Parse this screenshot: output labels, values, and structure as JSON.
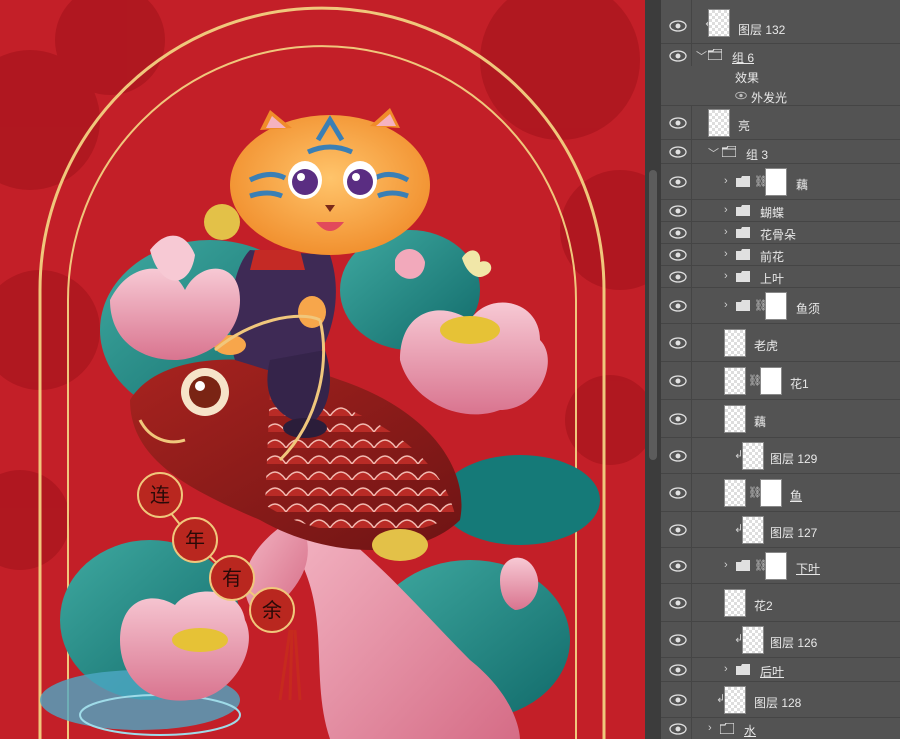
{
  "layers_panel": {
    "rows": [
      {
        "name": "图层 132"
      },
      {
        "name": "组 6"
      },
      {
        "name": "效果"
      },
      {
        "name": "外发光"
      },
      {
        "name": "亮"
      },
      {
        "name": "组 3"
      },
      {
        "name": "藕"
      },
      {
        "name": "蝴蝶"
      },
      {
        "name": "花骨朵"
      },
      {
        "name": "前花"
      },
      {
        "name": "上叶"
      },
      {
        "name": "鱼须"
      },
      {
        "name": "老虎"
      },
      {
        "name": "花1"
      },
      {
        "name": "藕"
      },
      {
        "name": "图层 129"
      },
      {
        "name": "鱼"
      },
      {
        "name": "图层 127"
      },
      {
        "name": "下叶"
      },
      {
        "name": "花2"
      },
      {
        "name": "图层 126"
      },
      {
        "name": "后叶"
      },
      {
        "name": "图层 128"
      },
      {
        "name": "水"
      }
    ]
  },
  "artwork": {
    "lantern_chars": [
      "连",
      "年",
      "有",
      "余"
    ]
  },
  "colors": {
    "canvas_red": "#c8202a",
    "panel_bg": "#535353",
    "gold_line": "#f0c77c"
  }
}
